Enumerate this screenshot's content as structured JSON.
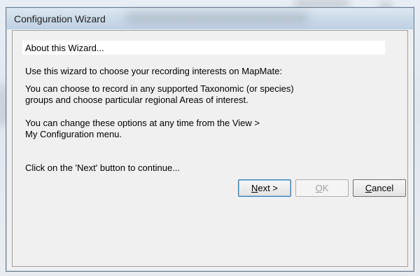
{
  "window": {
    "title": "Configuration Wizard"
  },
  "content": {
    "heading": "About this Wizard...",
    "para1": "Use this wizard to choose your recording interests on MapMate:",
    "para2_line1": "You can choose to record in any supported Taxonomic (or species)",
    "para2_line2": "groups and choose particular regional Areas of interest.",
    "para3_line1": "You can change these options at any time from the View >",
    "para3_line2": "My Configuration menu.",
    "para4": "Click on the 'Next' button to continue..."
  },
  "buttons": {
    "next": {
      "accel": "N",
      "rest": "ext >",
      "enabled": true
    },
    "ok": {
      "accel": "O",
      "rest": "K",
      "enabled": false
    },
    "cancel": {
      "accel": "C",
      "rest": "ancel",
      "enabled": true
    }
  },
  "colors": {
    "dialog_bg": "#f0f0f0",
    "titlebar": "#c8d9ea",
    "default_button_border": "#3c7fb1"
  }
}
